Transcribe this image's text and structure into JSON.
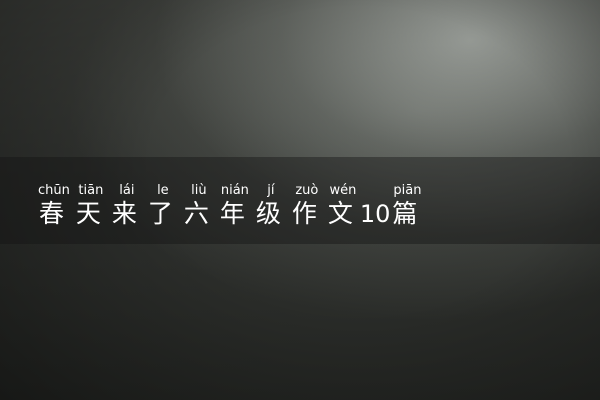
{
  "title": {
    "chars": [
      {
        "pinyin": "chūn",
        "hanzi": "春"
      },
      {
        "pinyin": "tiān",
        "hanzi": "天"
      },
      {
        "pinyin": "lái",
        "hanzi": "来"
      },
      {
        "pinyin": "le",
        "hanzi": "了"
      },
      {
        "pinyin": "liù",
        "hanzi": "六"
      },
      {
        "pinyin": "nián",
        "hanzi": "年"
      },
      {
        "pinyin": "jí",
        "hanzi": "级"
      },
      {
        "pinyin": "zuò",
        "hanzi": "作"
      },
      {
        "pinyin": "wén",
        "hanzi": "文"
      }
    ],
    "number": "10",
    "last": {
      "pinyin": "piān",
      "hanzi": "篇"
    }
  }
}
